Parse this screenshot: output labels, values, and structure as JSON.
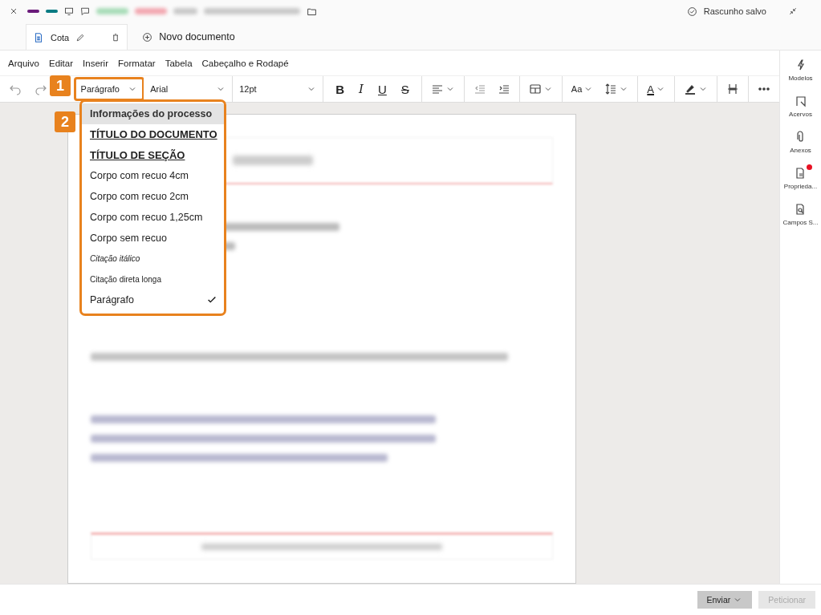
{
  "top_bar": {
    "status": "Rascunho salvo"
  },
  "tabs": [
    {
      "label": "Cota",
      "kind": "document",
      "selected": true
    },
    {
      "label": "Novo documento",
      "kind": "add",
      "selected": false
    }
  ],
  "menu": [
    "Arquivo",
    "Editar",
    "Inserir",
    "Formatar",
    "Tabela",
    "Cabeçalho e Rodapé"
  ],
  "toolbar": {
    "style": "Parágrafo",
    "font": "Arial",
    "size": "12pt",
    "format_buttons": [
      "B",
      "I",
      "U",
      "S"
    ],
    "case_button": "Aa",
    "color_button": "A"
  },
  "style_menu": {
    "items": [
      {
        "label": "Informações do processo",
        "kind": "info",
        "highlighted": true,
        "checked": false
      },
      {
        "label": "TÍTULO DO DOCUMENTO",
        "kind": "title",
        "highlighted": false,
        "checked": false
      },
      {
        "label": "TÍTULO DE SEÇÃO",
        "kind": "title",
        "highlighted": false,
        "checked": false
      },
      {
        "label": "Corpo com recuo 4cm",
        "kind": "body",
        "highlighted": false,
        "checked": false
      },
      {
        "label": "Corpo com recuo 2cm",
        "kind": "body",
        "highlighted": false,
        "checked": false
      },
      {
        "label": "Corpo com recuo 1,25cm",
        "kind": "body",
        "highlighted": false,
        "checked": false
      },
      {
        "label": "Corpo sem recuo",
        "kind": "body",
        "highlighted": false,
        "checked": false
      },
      {
        "label": "Citação itálico",
        "kind": "italic",
        "highlighted": false,
        "checked": false
      },
      {
        "label": "Citação direta longa",
        "kind": "small",
        "highlighted": false,
        "checked": false
      },
      {
        "label": "Parágrafo",
        "kind": "body",
        "highlighted": false,
        "checked": true
      }
    ]
  },
  "callouts": [
    "1",
    "2"
  ],
  "sidebar": [
    {
      "label": "Modelos",
      "kind": "bolt",
      "badge": false
    },
    {
      "label": "Acervos",
      "kind": "flag",
      "badge": false
    },
    {
      "label": "Anexos",
      "kind": "clip",
      "badge": false
    },
    {
      "label": "Proprieda...",
      "kind": "props",
      "badge": true
    },
    {
      "label": "Campos S...",
      "kind": "search-doc",
      "badge": false
    }
  ],
  "buttons": [
    {
      "label": "Enviar",
      "dropdown": true,
      "disabled": false
    },
    {
      "label": "Peticionar",
      "dropdown": false,
      "disabled": true
    }
  ]
}
